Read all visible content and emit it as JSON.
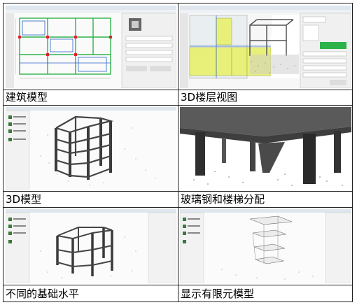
{
  "cells": [
    {
      "caption": "建筑模型",
      "image": "architectural-floor-plan-software-screenshot"
    },
    {
      "caption": "3D楼层视图",
      "image": "3d-floor-view-software-screenshot"
    },
    {
      "caption": "3D模型",
      "image": "3d-building-frame-model-screenshot"
    },
    {
      "caption": "玻璃钢和楼梯分配",
      "image": "steel-frame-and-stair-closeup-render"
    },
    {
      "caption": "不同的基础水平",
      "image": "different-foundation-levels-3d-frame-screenshot"
    },
    {
      "caption": "显示有限元模型",
      "image": "finite-element-model-display-screenshot"
    }
  ],
  "colors": {
    "border": "#222222",
    "frame": "#3a3a3a",
    "plan_green": "#2db34a",
    "plan_blue": "#2a62c9",
    "panel_yellow": "#e8f07a"
  }
}
